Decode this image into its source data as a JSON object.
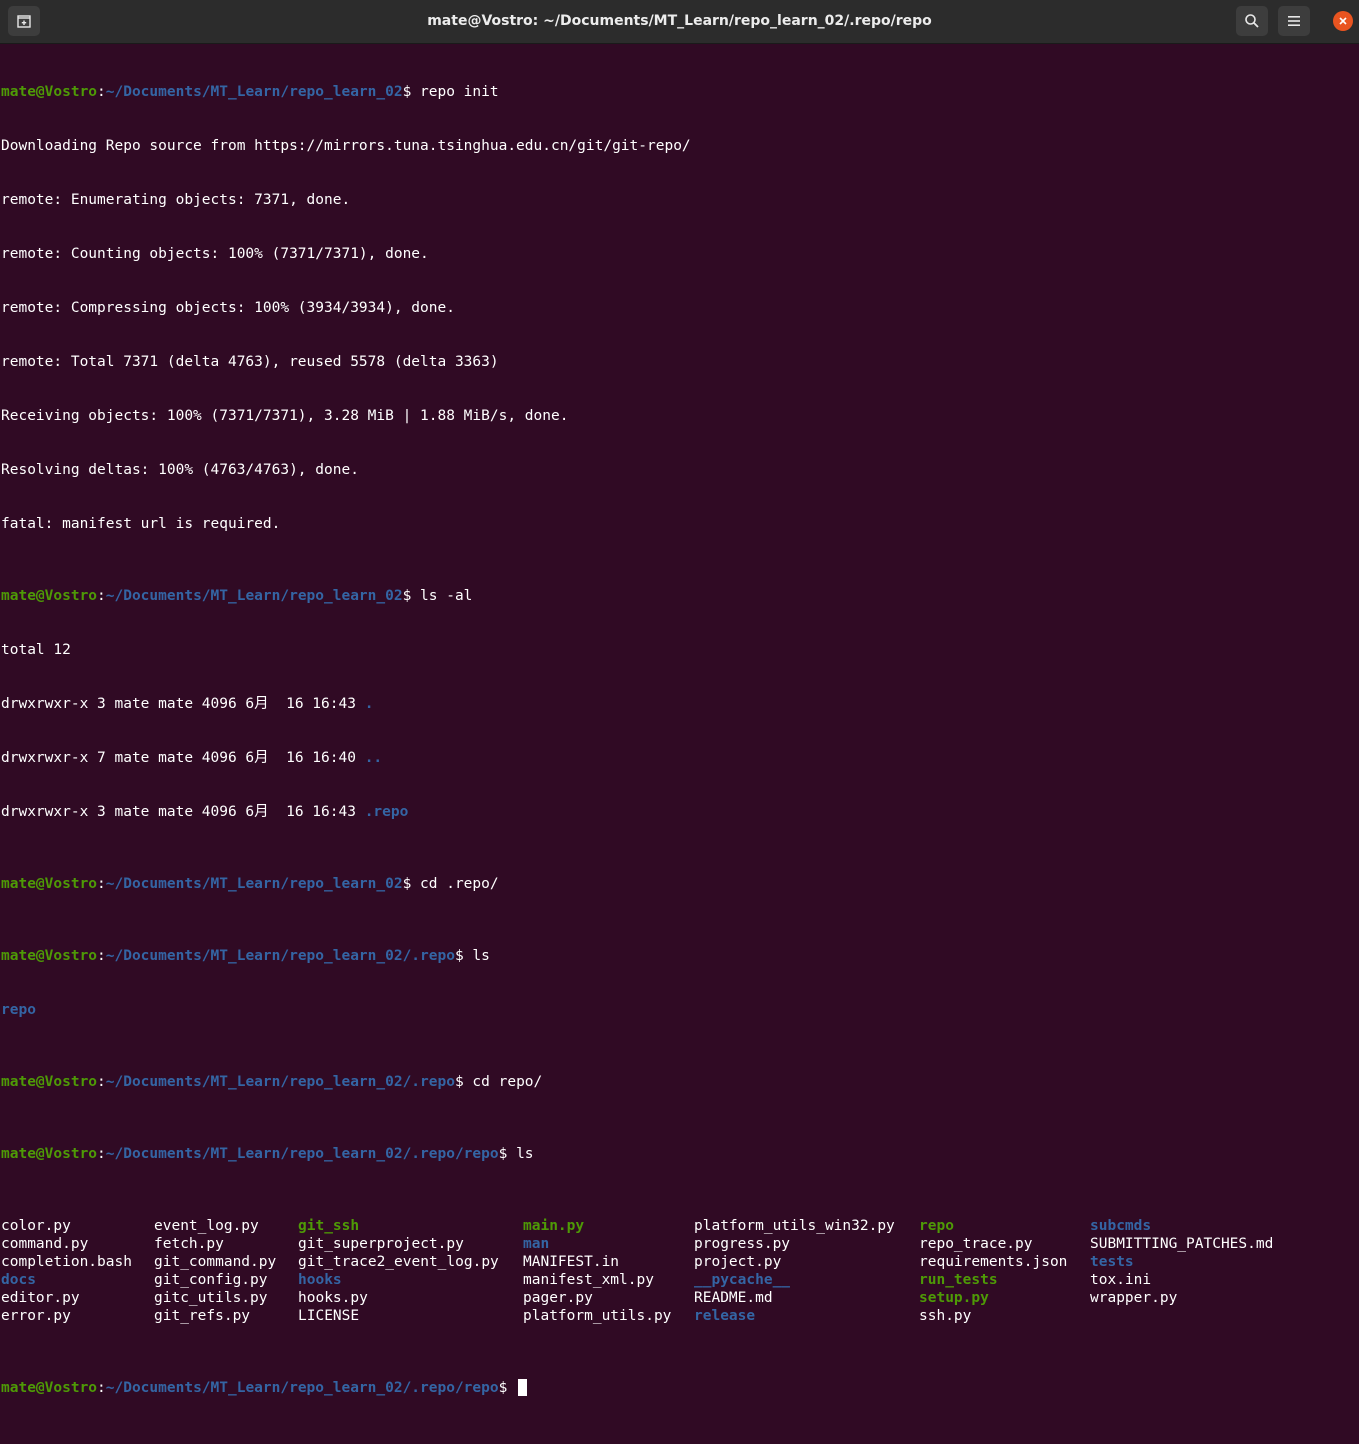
{
  "window": {
    "title": "mate@Vostro: ~/Documents/MT_Learn/repo_learn_02/.repo/repo",
    "icons": {
      "new_tab": "new-tab-icon",
      "search": "search-icon",
      "menu": "hamburger-menu-icon",
      "close": "close-icon"
    },
    "colors": {
      "background": "#300a24",
      "prompt_user": "#4e9a06",
      "prompt_path": "#3465a4",
      "directory": "#3465a4",
      "executable": "#4e9a06",
      "close_button": "#e95420"
    }
  },
  "prompt": {
    "user": "mate@Vostro",
    "sep": ":"
  },
  "block1": {
    "path": "~/Documents/MT_Learn/repo_learn_02",
    "cmd": "$ repo init",
    "out": [
      "Downloading Repo source from https://mirrors.tuna.tsinghua.edu.cn/git/git-repo/",
      "remote: Enumerating objects: 7371, done.",
      "remote: Counting objects: 100% (7371/7371), done.",
      "remote: Compressing objects: 100% (3934/3934), done.",
      "remote: Total 7371 (delta 4763), reused 5578 (delta 3363)",
      "Receiving objects: 100% (7371/7371), 3.28 MiB | 1.88 MiB/s, done.",
      "Resolving deltas: 100% (4763/4763), done.",
      "fatal: manifest url is required."
    ]
  },
  "block2": {
    "path": "~/Documents/MT_Learn/repo_learn_02",
    "cmd": "$ ls -al",
    "total": "total 12",
    "rows": [
      {
        "meta": "drwxrwxr-x 3 mate mate 4096 6月  16 16:43 ",
        "name": "."
      },
      {
        "meta": "drwxrwxr-x 7 mate mate 4096 6月  16 16:40 ",
        "name": ".."
      },
      {
        "meta": "drwxrwxr-x 3 mate mate 4096 6月  16 16:43 ",
        "name": ".repo"
      }
    ]
  },
  "block3": {
    "path": "~/Documents/MT_Learn/repo_learn_02",
    "cmd": "$ cd .repo/"
  },
  "block4": {
    "path": "~/Documents/MT_Learn/repo_learn_02/.repo",
    "cmd": "$ ls",
    "out": "repo"
  },
  "block5": {
    "path": "~/Documents/MT_Learn/repo_learn_02/.repo",
    "cmd": "$ cd repo/"
  },
  "block6": {
    "path": "~/Documents/MT_Learn/repo_learn_02/.repo/repo",
    "cmd": "$ ls",
    "files": [
      [
        "color.py",
        "command.py",
        "completion.bash",
        "docs",
        "editor.py",
        "error.py"
      ],
      [
        "event_log.py",
        "fetch.py",
        "git_command.py",
        "git_config.py",
        "gitc_utils.py",
        "git_refs.py"
      ],
      [
        "git_ssh",
        "git_superproject.py",
        "git_trace2_event_log.py",
        "hooks",
        "hooks.py",
        "LICENSE"
      ],
      [
        "main.py",
        "man",
        "MANIFEST.in",
        "manifest_xml.py",
        "pager.py",
        "platform_utils.py"
      ],
      [
        "platform_utils_win32.py",
        "progress.py",
        "project.py",
        "__pycache__",
        "README.md",
        "release"
      ],
      [
        "repo",
        "repo_trace.py",
        "requirements.json",
        "run_tests",
        "setup.py",
        "ssh.py"
      ],
      [
        "subcmds",
        "SUBMITTING_PATCHES.md",
        "tests",
        "tox.ini",
        "wrapper.py"
      ]
    ]
  },
  "block7": {
    "path": "~/Documents/MT_Learn/repo_learn_02/.repo/repo",
    "cmd": "$ "
  }
}
